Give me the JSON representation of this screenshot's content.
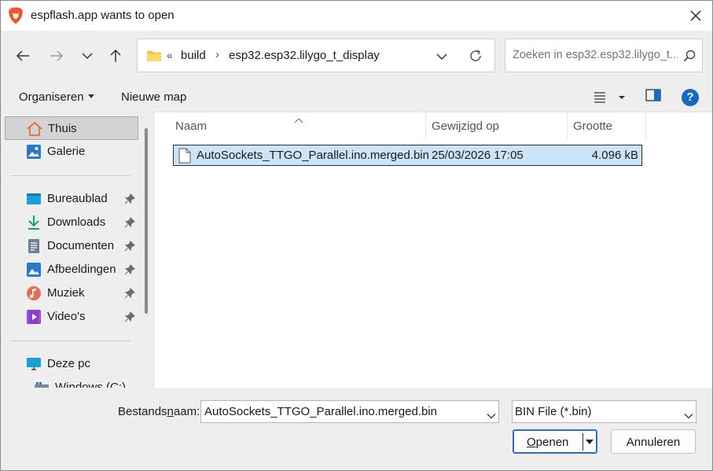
{
  "window": {
    "title": "espflash.app wants to open",
    "close_icon": "close-icon"
  },
  "nav": {
    "back_icon": "arrow-left-icon",
    "forward_icon": "arrow-right-icon",
    "recent_icon": "chevron-down-icon",
    "up_icon": "arrow-up-icon"
  },
  "address": {
    "overflow_marker": "«",
    "breadcrumbs": [
      "build",
      "esp32.esp32.lilygo_t_display"
    ],
    "separator": "›"
  },
  "search": {
    "placeholder": "Zoeken in esp32.esp32.lilygo_t..."
  },
  "toolbar": {
    "organize_label": "Organiseren",
    "new_folder_label": "Nieuwe map",
    "help_label": "?"
  },
  "sidebar": {
    "items": [
      {
        "label": "Thuis",
        "icon": "home-icon",
        "selected": true,
        "pinned": false
      },
      {
        "label": "Galerie",
        "icon": "gallery-icon",
        "selected": false,
        "pinned": false
      },
      {
        "label": "Bureaublad",
        "icon": "desktop-icon",
        "selected": false,
        "pinned": true
      },
      {
        "label": "Downloads",
        "icon": "download-icon",
        "selected": false,
        "pinned": true
      },
      {
        "label": "Documenten",
        "icon": "document-icon",
        "selected": false,
        "pinned": true
      },
      {
        "label": "Afbeeldingen",
        "icon": "pictures-icon",
        "selected": false,
        "pinned": true
      },
      {
        "label": "Muziek",
        "icon": "music-icon",
        "selected": false,
        "pinned": true
      },
      {
        "label": "Video's",
        "icon": "video-icon",
        "selected": false,
        "pinned": true
      },
      {
        "label": "Deze pc",
        "icon": "pc-icon",
        "selected": false,
        "pinned": false
      },
      {
        "label": "Windows (C:)",
        "icon": "drive-icon",
        "selected": false,
        "pinned": false
      }
    ]
  },
  "file_list": {
    "columns": [
      "Naam",
      "Gewijzigd op",
      "Grootte"
    ],
    "rows": [
      {
        "name": "AutoSockets_TTGO_Parallel.ino.merged.bin",
        "modified": "25/03/2026 17:05",
        "size": "4.096 kB",
        "selected": true
      }
    ]
  },
  "footer": {
    "filename_label_prefix": "Bestands",
    "filename_label_underlined": "n",
    "filename_label_suffix": "aam:",
    "filename_value": "AutoSockets_TTGO_Parallel.ino.merged.bin",
    "filetype_value": "BIN File (*.bin)",
    "open_label_underlined": "O",
    "open_label_rest": "penen",
    "cancel_label": "Annuleren"
  },
  "colors": {
    "selection": "#cce4f7",
    "accent": "#1668c4",
    "chrome": "#eeeeee"
  }
}
